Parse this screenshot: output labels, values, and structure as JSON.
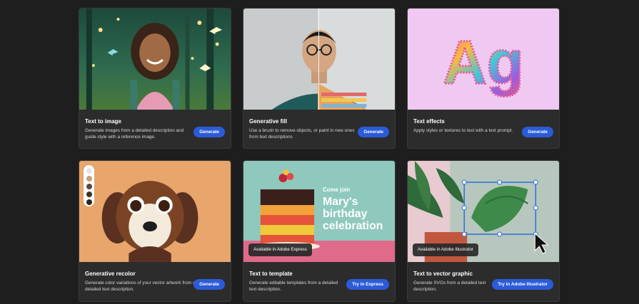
{
  "colors": {
    "background": "#1e1e1e",
    "card": "#2c2c2c",
    "accent_button": "#2b5bd8"
  },
  "cards": [
    {
      "title": "Text to image",
      "description": "Generate images from a detailed description and guide style with a reference image.",
      "button": "Generate",
      "badge": ""
    },
    {
      "title": "Generative fill",
      "description": "Use a brush to remove objects, or paint in new ones from text descriptions",
      "button": "Generate",
      "badge": ""
    },
    {
      "title": "Text effects",
      "description": "Apply styles or textures to text with a text prompt.",
      "button": "Generate",
      "badge": "",
      "sample_text": "Ag"
    },
    {
      "title": "Generative recolor",
      "description": "Generate color variations of your vector artwork from a detailed text description.",
      "button": "Generate",
      "badge": ""
    },
    {
      "title": "Text to template",
      "description": "Generate editable templates from a detailed text description.",
      "button": "Try in Express",
      "badge": "Available in Adobe Express",
      "poster": {
        "line1": "Come join",
        "line2": "Mary's",
        "line3": "birthday",
        "line4": "celebration"
      }
    },
    {
      "title": "Text to vector graphic",
      "description": "Generate SVGs from a detailed text description.",
      "button": "Try in Adobe Illustrator",
      "badge": "Available in Adobe Illustrator"
    }
  ]
}
